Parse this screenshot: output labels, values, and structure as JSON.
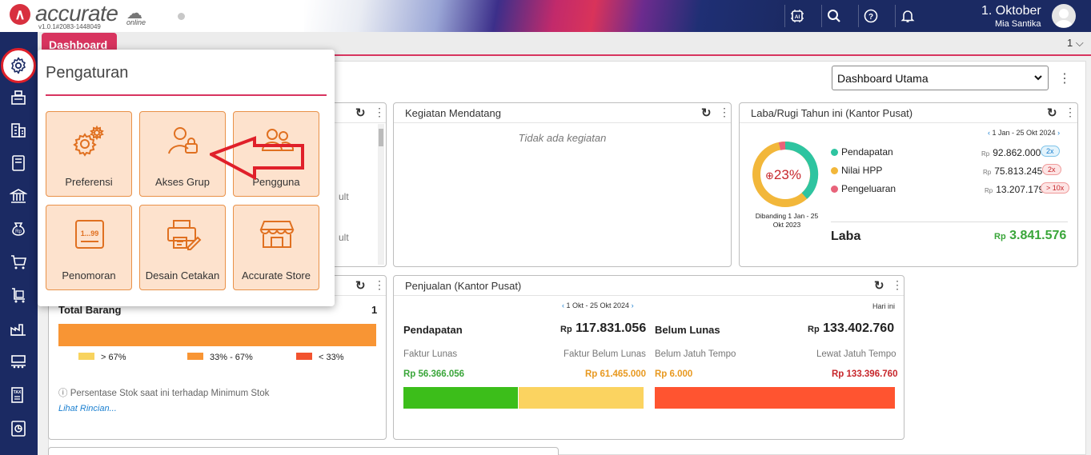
{
  "header": {
    "logo": "accurate",
    "logo_suffix": "online",
    "version": "v1.0.1#2083-1448049",
    "date": "1. Oktober",
    "user": "Mia Santika",
    "icons": [
      "ai-icon",
      "search-icon",
      "help-icon",
      "bell-icon"
    ]
  },
  "tabs": {
    "active": "Dashboard",
    "counter": "1"
  },
  "dashboard": {
    "selector": "Dashboard Utama"
  },
  "menu": {
    "title": "Pengaturan",
    "tiles": [
      {
        "label": "Preferensi",
        "icon": "gears-icon"
      },
      {
        "label": "Akses Grup",
        "icon": "user-lock-icon"
      },
      {
        "label": "Pengguna",
        "icon": "users-icon"
      },
      {
        "label": "Penomoran",
        "icon": "numbering-icon"
      },
      {
        "label": "Desain Cetakan",
        "icon": "printer-design-icon"
      },
      {
        "label": "Accurate Store",
        "icon": "store-icon"
      }
    ]
  },
  "cards": {
    "left_partial": {
      "frag1": "ult",
      "frag2": "ult"
    },
    "kegiatan": {
      "title": "Kegiatan Mendatang",
      "empty": "Tidak ada kegiatan"
    },
    "labarugi": {
      "title": "Laba/Rugi Tahun ini (Kantor Pusat)",
      "period": "1 Jan - 25 Okt 2024",
      "percent": "23%",
      "compare": "Dibanding 1 Jan - 25 Okt 2023",
      "currency": "Rp",
      "rows": [
        {
          "label": "Pendapatan",
          "value": "92.862.000",
          "pill": "2x",
          "color": "#2ec4a0"
        },
        {
          "label": "Nilai HPP",
          "value": "75.813.245",
          "pill": "2x",
          "color": "#f2b73a"
        },
        {
          "label": "Pengeluaran",
          "value": "13.207.179",
          "pill": "> 10x",
          "color": "#e8637a"
        }
      ],
      "laba_label": "Laba",
      "laba_value": "3.841.576"
    },
    "barang": {
      "title": "Total Barang",
      "count": "1",
      "legend": [
        "> 67%",
        "33% - 67%",
        "< 33%"
      ],
      "note": "Persentase Stok saat ini terhadap Minimum Stok",
      "link": "Lihat Rincian..."
    },
    "penjualan": {
      "title": "Penjualan (Kantor Pusat)",
      "period": "1 Okt - 25 Okt 2024",
      "today": "Hari ini",
      "currency": "Rp",
      "pendapatan_label": "Pendapatan",
      "pendapatan_value": "117.831.056",
      "belum_label": "Belum Lunas",
      "belum_value": "133.402.760",
      "faktur_lunas": "Faktur Lunas",
      "faktur_belum": "Faktur Belum Lunas",
      "belum_jatuh": "Belum Jatuh Tempo",
      "lewat_jatuh": "Lewat Jatuh Tempo",
      "v_lunas": "Rp 56.366.056",
      "v_belum": "Rp 61.465.000",
      "v_belum_jatuh": "Rp 6.000",
      "v_lewat": "Rp 133.396.760"
    }
  },
  "colors": {
    "brand": "#1b2a63",
    "accent": "#d8345f",
    "tile_bg": "#fde2cd",
    "tile_border": "#e99148"
  }
}
